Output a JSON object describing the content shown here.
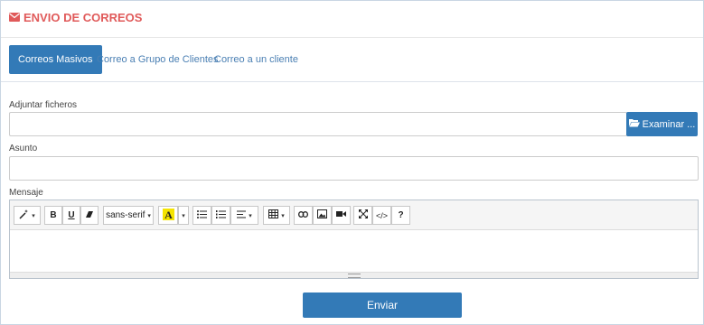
{
  "header": {
    "title": "ENVIO DE CORREOS",
    "icon": "envelope-icon",
    "title_color": "#e05a5a"
  },
  "tabs": [
    {
      "label": "Correos Masivos",
      "active": true
    },
    {
      "label": "Correo a Grupo de Clientes",
      "active": false
    },
    {
      "label": "Correo a un cliente",
      "active": false
    }
  ],
  "form": {
    "attach_label": "Adjuntar ficheros",
    "attach_value": "",
    "browse_label": "Examinar ...",
    "subject_label": "Asunto",
    "subject_value": "",
    "message_label": "Mensaje",
    "message_value": ""
  },
  "toolbar": {
    "font_name": "sans-serif",
    "bold": "B",
    "underline": "U",
    "help": "?",
    "code": "</>"
  },
  "actions": {
    "send_label": "Enviar"
  },
  "colors": {
    "primary": "#337ab7",
    "accent": "#e05a5a"
  }
}
